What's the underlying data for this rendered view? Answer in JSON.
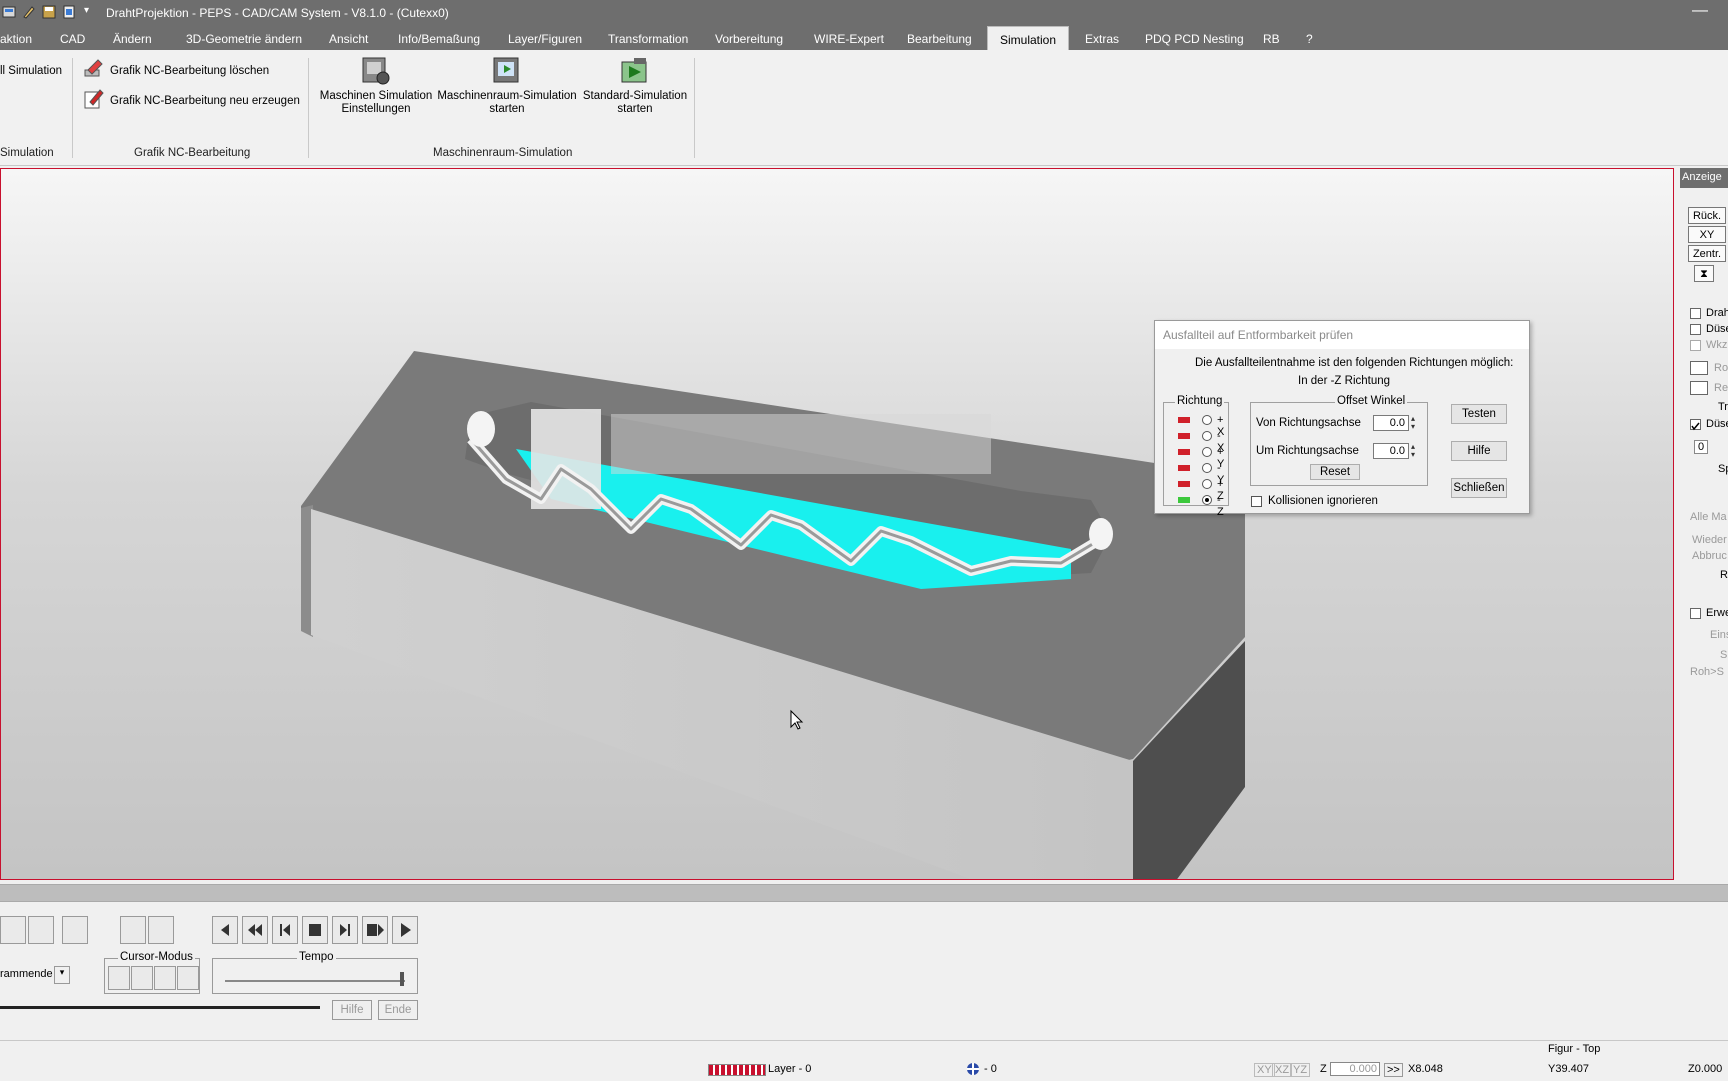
{
  "titlebar": {
    "title": "DrahtProjektion - PEPS - CAD/CAM System -  V8.1.0 - (Cutexx0)",
    "minimize": "—"
  },
  "menu": {
    "tabs": [
      "aktion",
      "CAD",
      "Ändern",
      "3D-Geometrie ändern",
      "Ansicht",
      "Info/Bemaßung",
      "Layer/Figuren",
      "Transformation",
      "Vorbereitung",
      "WIRE-Expert",
      "Bearbeitung",
      "Simulation",
      "Extras",
      "PDQ PCD Nesting",
      "RB",
      "?"
    ],
    "active": "Simulation"
  },
  "ribbon": {
    "left_item": "ll Simulation",
    "left_group": "Simulation",
    "grafik": {
      "delete": "Grafik NC-Bearbeitung löschen",
      "regen": "Grafik NC-Bearbeitung neu erzeugen",
      "group": "Grafik NC-Bearbeitung"
    },
    "maschinen": {
      "settings_l1": "Maschinen Simulation",
      "settings_l2": "Einstellungen",
      "room_l1": "Maschinenraum-Simulation",
      "room_l2": "starten",
      "std_l1": "Standard-Simulation",
      "std_l2": "starten",
      "group": "Maschinenraum-Simulation"
    }
  },
  "right_panel": {
    "header": "Anzeige",
    "buttons": [
      "Rück.",
      "XY",
      "Zentr."
    ],
    "checks": [
      {
        "label": "Drah",
        "enabled": true
      },
      {
        "label": "Düse",
        "enabled": true
      },
      {
        "label": "Wkz",
        "enabled": false
      }
    ],
    "items": [
      "Ro",
      "Re",
      "Tr",
      "Düse",
      "0",
      "Sp",
      "Alle Ma",
      "Wieder",
      "Abbruc",
      "R",
      "Erwe",
      "Eins",
      "S",
      "Roh>S"
    ]
  },
  "dialog": {
    "title": "Ausfallteil auf Entformbarkeit prüfen",
    "message": "Die Ausfallteilentnahme ist den folgenden Richtungen möglich:",
    "direction_text": "In der -Z Richtung",
    "richtung_label": "Richtung",
    "directions": [
      {
        "label": "+ X",
        "color": "#d0202a",
        "selected": false
      },
      {
        "label": "- X",
        "color": "#d0202a",
        "selected": false
      },
      {
        "label": "+ Y",
        "color": "#d0202a",
        "selected": false
      },
      {
        "label": "- Y",
        "color": "#d0202a",
        "selected": false
      },
      {
        "label": "+ Z",
        "color": "#d0202a",
        "selected": false
      },
      {
        "label": "- Z",
        "color": "#3cc83c",
        "selected": true
      }
    ],
    "offset_label": "Offset Winkel",
    "von_label": "Von Richtungsachse",
    "von_value": "0.0",
    "um_label": "Um Richtungsachse",
    "um_value": "0.0",
    "reset": "Reset",
    "testen": "Testen",
    "hilfe": "Hilfe",
    "schliessen": "Schließen",
    "collision_label": "Kollisionen ignorieren"
  },
  "bottom": {
    "cursor_label": "Cursor-Modus",
    "tempo_label": "Tempo",
    "combo": "rammende",
    "hilfe": "Hilfe",
    "ende": "Ende"
  },
  "status": {
    "figur": "Figur  - Top",
    "layer": "Layer - 0",
    "zero": "- 0",
    "xy": "XY",
    "xz": "XZ",
    "yz": "YZ",
    "z_label": "Z",
    "z_value": "0.000",
    "arrows": ">>",
    "x": "X8.048",
    "y": "Y39.407",
    "z": "Z0.000"
  },
  "colors": {
    "accent_bar": "#6e6e6e",
    "viewport_border": "#c8102e",
    "pocket_fill": "#19f0ee",
    "ok_flag": "#3cc83c",
    "bad_flag": "#d0202a"
  }
}
